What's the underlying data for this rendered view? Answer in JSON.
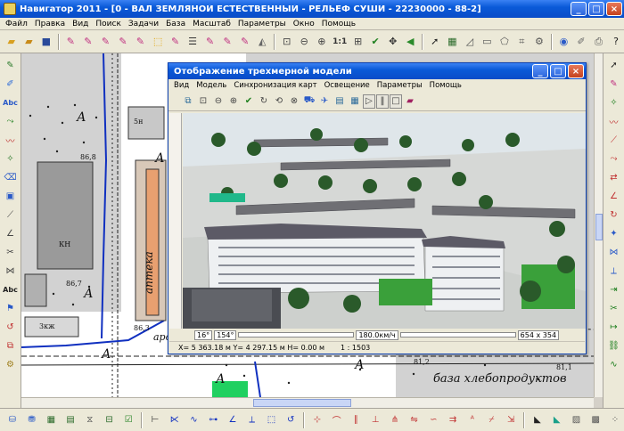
{
  "window": {
    "title": "Навигатор 2011 - [0 - ВАЛ ЗЕМЛЯНОЙ ЕСТЕСТВЕННЫЙ - РЕЛЬЕФ СУШИ - 22230000 - 88-2]"
  },
  "menu": [
    "Файл",
    "Правка",
    "Вид",
    "Поиск",
    "Задачи",
    "База",
    "Масштаб",
    "Параметры",
    "Окно",
    "Помощь"
  ],
  "toolbar": {
    "scale_label": "1:1"
  },
  "left_tools": {
    "abc1": "Abc",
    "abc2": "Abc"
  },
  "map": {
    "labels": {
      "a1": "А",
      "a2": "А",
      "a3": "А",
      "a4": "А",
      "a5": "А",
      "a6": "А",
      "n1": "86,8",
      "n2": "86,7",
      "n3": "86,3",
      "n4": "81,2",
      "n5": "81,1",
      "kn": "КН",
      "sn": "5н",
      "zkzh": "3кж",
      "apteka": "аптека",
      "aro": "аро",
      "baza": "база хлебопродуктов"
    }
  },
  "dialog": {
    "title": "Отображение трехмерной модели",
    "menu": [
      "Вид",
      "Модель",
      "Синхронизация карт",
      "Освещение",
      "Параметры",
      "Помощь"
    ],
    "controls": {
      "angle1": "16°",
      "angle2": "154°",
      "speed": "180.0км/ч",
      "size": "654 x 354"
    },
    "status": {
      "coords": "X= 5 363.18 м  Y= 4 297.15 м  H= 0.00 м",
      "scale": "1 : 1503"
    }
  },
  "colors": {
    "title_blue": "#0a5ad8",
    "panel": "#ece9d8",
    "building_green": "#20d060"
  }
}
